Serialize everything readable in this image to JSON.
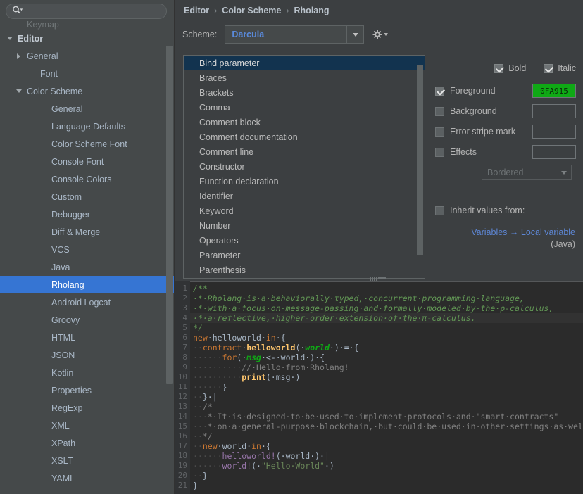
{
  "search": {
    "placeholder": "",
    "value": "",
    "icon": "search-icon"
  },
  "sidebar": {
    "items": [
      {
        "label": "Keymap",
        "level": 1,
        "arrow": "none",
        "state": "clipped"
      },
      {
        "label": "Editor",
        "level": 0,
        "arrow": "down",
        "state": "bold"
      },
      {
        "label": "General",
        "level": 1,
        "arrow": "right",
        "state": "normal"
      },
      {
        "label": "Font",
        "level": 2,
        "arrow": "none",
        "state": "normal"
      },
      {
        "label": "Color Scheme",
        "level": 1,
        "arrow": "down",
        "state": "normal"
      },
      {
        "label": "General",
        "level": 3,
        "arrow": "none",
        "state": "normal"
      },
      {
        "label": "Language Defaults",
        "level": 3,
        "arrow": "none",
        "state": "normal"
      },
      {
        "label": "Color Scheme Font",
        "level": 3,
        "arrow": "none",
        "state": "normal"
      },
      {
        "label": "Console Font",
        "level": 3,
        "arrow": "none",
        "state": "normal"
      },
      {
        "label": "Console Colors",
        "level": 3,
        "arrow": "none",
        "state": "normal"
      },
      {
        "label": "Custom",
        "level": 3,
        "arrow": "none",
        "state": "normal"
      },
      {
        "label": "Debugger",
        "level": 3,
        "arrow": "none",
        "state": "normal"
      },
      {
        "label": "Diff & Merge",
        "level": 3,
        "arrow": "none",
        "state": "normal"
      },
      {
        "label": "VCS",
        "level": 3,
        "arrow": "none",
        "state": "normal"
      },
      {
        "label": "Java",
        "level": 3,
        "arrow": "none",
        "state": "normal"
      },
      {
        "label": "Rholang",
        "level": 3,
        "arrow": "none",
        "state": "selected"
      },
      {
        "label": "Android Logcat",
        "level": 3,
        "arrow": "none",
        "state": "normal"
      },
      {
        "label": "Groovy",
        "level": 3,
        "arrow": "none",
        "state": "normal"
      },
      {
        "label": "HTML",
        "level": 3,
        "arrow": "none",
        "state": "normal"
      },
      {
        "label": "JSON",
        "level": 3,
        "arrow": "none",
        "state": "normal"
      },
      {
        "label": "Kotlin",
        "level": 3,
        "arrow": "none",
        "state": "normal"
      },
      {
        "label": "Properties",
        "level": 3,
        "arrow": "none",
        "state": "normal"
      },
      {
        "label": "RegExp",
        "level": 3,
        "arrow": "none",
        "state": "normal"
      },
      {
        "label": "XML",
        "level": 3,
        "arrow": "none",
        "state": "normal"
      },
      {
        "label": "XPath",
        "level": 3,
        "arrow": "none",
        "state": "normal"
      },
      {
        "label": "XSLT",
        "level": 3,
        "arrow": "none",
        "state": "normal"
      },
      {
        "label": "YAML",
        "level": 3,
        "arrow": "none",
        "state": "normal"
      }
    ]
  },
  "breadcrumb": {
    "items": [
      "Editor",
      "Color Scheme",
      "Rholang"
    ],
    "separator": "›"
  },
  "scheme": {
    "label": "Scheme:",
    "value": "Darcula",
    "dropdown_icon": "chevron-down-icon",
    "gear_icon": "gear-icon"
  },
  "options": {
    "items": [
      "Bind parameter",
      "Braces",
      "Brackets",
      "Comma",
      "Comment block",
      "Comment documentation",
      "Comment line",
      "Constructor",
      "Function declaration",
      "Identifier",
      "Keyword",
      "Number",
      "Operators",
      "Parameter",
      "Parenthesis"
    ],
    "selected": "Bind parameter"
  },
  "attributes": {
    "bold": {
      "label": "Bold",
      "checked": true
    },
    "italic": {
      "label": "Italic",
      "checked": true
    },
    "foreground": {
      "label": "Foreground",
      "checked": true,
      "value": "0FA915",
      "color": "#0fa915"
    },
    "background": {
      "label": "Background",
      "checked": false,
      "value": ""
    },
    "error_stripe": {
      "label": "Error stripe mark",
      "checked": false,
      "value": ""
    },
    "effects": {
      "label": "Effects",
      "checked": false,
      "value": ""
    },
    "effect_type": {
      "value": "Bordered",
      "dropdown_icon": "chevron-down-icon"
    },
    "inherit": {
      "label": "Inherit values from:",
      "checked": false,
      "link": "Variables → Local variable",
      "sub": "(Java)"
    }
  },
  "preview": {
    "lines": [
      {
        "n": "1",
        "hl": false,
        "tokens": [
          {
            "t": "/**",
            "c": "c-doc"
          }
        ]
      },
      {
        "n": "2",
        "hl": false,
        "tokens": [
          {
            "t": " * Rholang is a behaviorally typed, concurrent programming language,",
            "c": "c-doc"
          }
        ]
      },
      {
        "n": "3",
        "hl": false,
        "tokens": [
          {
            "t": " * with a focus on message-passing and formally modeled by the ρ-calculus,",
            "c": "c-doc"
          }
        ]
      },
      {
        "n": "4",
        "hl": true,
        "tokens": [
          {
            "t": " * a reflective, higher-order extension of the π-calculus.",
            "c": "c-doc"
          }
        ]
      },
      {
        "n": "5",
        "hl": false,
        "tokens": [
          {
            "t": "*/",
            "c": "c-doc"
          }
        ]
      },
      {
        "n": "6",
        "hl": false,
        "tokens": [
          {
            "t": "new",
            "c": "c-kw"
          },
          {
            "t": " helloworld ",
            "c": "c-id"
          },
          {
            "t": "in",
            "c": "c-kw"
          },
          {
            "t": " {",
            "c": "c-id"
          }
        ]
      },
      {
        "n": "7",
        "hl": false,
        "tokens": [
          {
            "t": "  ",
            "c": "c-ws"
          },
          {
            "t": "contract",
            "c": "c-kw"
          },
          {
            "t": " ",
            "c": "c-id"
          },
          {
            "t": "helloworld",
            "c": "c-fn"
          },
          {
            "t": "( ",
            "c": "c-id"
          },
          {
            "t": "world",
            "c": "c-bnd"
          },
          {
            "t": " ) = {",
            "c": "c-id"
          }
        ]
      },
      {
        "n": "8",
        "hl": false,
        "tokens": [
          {
            "t": "      ",
            "c": "c-ws"
          },
          {
            "t": "for",
            "c": "c-kw"
          },
          {
            "t": "( ",
            "c": "c-id"
          },
          {
            "t": "msg",
            "c": "c-bnd"
          },
          {
            "t": " <- ",
            "c": "c-id"
          },
          {
            "t": "world",
            "c": "c-id"
          },
          {
            "t": " ) {",
            "c": "c-id"
          }
        ]
      },
      {
        "n": "9",
        "hl": false,
        "tokens": [
          {
            "t": "          ",
            "c": "c-ws"
          },
          {
            "t": "// Hello from Rholang!",
            "c": "c-cmt"
          }
        ]
      },
      {
        "n": "10",
        "hl": false,
        "tokens": [
          {
            "t": "          ",
            "c": "c-ws"
          },
          {
            "t": "print",
            "c": "c-fn"
          },
          {
            "t": "( ",
            "c": "c-id"
          },
          {
            "t": "msg",
            "c": "c-id"
          },
          {
            "t": " )",
            "c": "c-id"
          }
        ]
      },
      {
        "n": "11",
        "hl": false,
        "tokens": [
          {
            "t": "      ",
            "c": "c-ws"
          },
          {
            "t": "}",
            "c": "c-id"
          }
        ]
      },
      {
        "n": "12",
        "hl": false,
        "tokens": [
          {
            "t": "  ",
            "c": "c-ws"
          },
          {
            "t": "} |",
            "c": "c-id"
          }
        ]
      },
      {
        "n": "13",
        "hl": false,
        "tokens": [
          {
            "t": "  ",
            "c": "c-ws"
          },
          {
            "t": "/*",
            "c": "c-cmt"
          }
        ]
      },
      {
        "n": "14",
        "hl": false,
        "tokens": [
          {
            "t": "   ",
            "c": "c-ws"
          },
          {
            "t": "* It is designed to be used to implement protocols and \"smart contracts\"",
            "c": "c-cmt"
          }
        ]
      },
      {
        "n": "15",
        "hl": false,
        "tokens": [
          {
            "t": "   ",
            "c": "c-ws"
          },
          {
            "t": "* on a general-purpose blockchain, but could be used in other settings as well.",
            "c": "c-cmt"
          }
        ]
      },
      {
        "n": "16",
        "hl": false,
        "tokens": [
          {
            "t": "  ",
            "c": "c-ws"
          },
          {
            "t": "*/",
            "c": "c-cmt"
          }
        ]
      },
      {
        "n": "17",
        "hl": false,
        "tokens": [
          {
            "t": "  ",
            "c": "c-ws"
          },
          {
            "t": "new",
            "c": "c-kw"
          },
          {
            "t": " world ",
            "c": "c-id"
          },
          {
            "t": "in",
            "c": "c-kw"
          },
          {
            "t": " {",
            "c": "c-id"
          }
        ]
      },
      {
        "n": "18",
        "hl": false,
        "tokens": [
          {
            "t": "      ",
            "c": "c-ws"
          },
          {
            "t": "helloworld!",
            "c": "c-purple"
          },
          {
            "t": "( ",
            "c": "c-id"
          },
          {
            "t": "world",
            "c": "c-id"
          },
          {
            "t": " ) |",
            "c": "c-id"
          }
        ]
      },
      {
        "n": "19",
        "hl": false,
        "tokens": [
          {
            "t": "      ",
            "c": "c-ws"
          },
          {
            "t": "world!",
            "c": "c-purple"
          },
          {
            "t": "( ",
            "c": "c-id"
          },
          {
            "t": "\"Hello World\"",
            "c": "c-str"
          },
          {
            "t": " )",
            "c": "c-id"
          }
        ]
      },
      {
        "n": "20",
        "hl": false,
        "tokens": [
          {
            "t": "  ",
            "c": "c-ws"
          },
          {
            "t": "}",
            "c": "c-id"
          }
        ]
      },
      {
        "n": "21",
        "hl": false,
        "tokens": [
          {
            "t": "}",
            "c": "c-id"
          }
        ]
      }
    ]
  }
}
